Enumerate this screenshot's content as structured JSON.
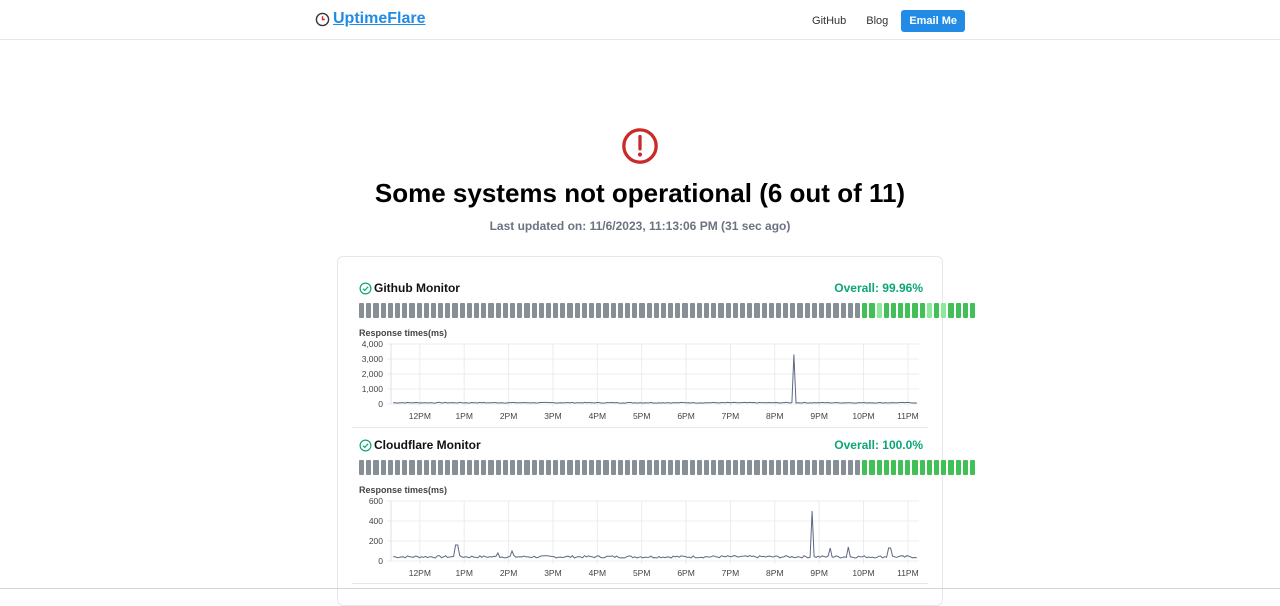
{
  "header": {
    "brand": "UptimeFlare",
    "nav": {
      "github": "GitHub",
      "blog": "Blog",
      "email": "Email Me"
    }
  },
  "status": {
    "headline": "Some systems not operational (6 out of 11)",
    "updated": "Last updated on: 11/6/2023, 11:13:06 PM (31 sec ago)"
  },
  "colors": {
    "accent": "#228be6",
    "up": "#40c057",
    "up_light": "#8ce99a",
    "no_data": "#868e96",
    "alert": "#c92a2a",
    "overall": "#0ca678"
  },
  "monitors": [
    {
      "name": "Github Monitor",
      "overall": "Overall: 99.96%",
      "response_label": "Response times(ms)",
      "bars": {
        "no_data": 70,
        "up": 16,
        "partial_indices": [
          2,
          9,
          11
        ]
      },
      "chart_data": {
        "type": "line",
        "x_ticks": [
          "12PM",
          "1PM",
          "2PM",
          "3PM",
          "4PM",
          "5PM",
          "6PM",
          "7PM",
          "8PM",
          "9PM",
          "10PM",
          "11PM"
        ],
        "y_ticks": [
          "4,000",
          "3,000",
          "2,000",
          "1,000",
          "0"
        ],
        "ylim": [
          0,
          4000
        ],
        "baseline_ms": 80,
        "spikes": [
          {
            "time": "8:25PM",
            "value": 3300
          }
        ]
      }
    },
    {
      "name": "Cloudflare Monitor",
      "overall": "Overall: 100.0%",
      "response_label": "Response times(ms)",
      "bars": {
        "no_data": 70,
        "up": 16,
        "partial_indices": []
      },
      "chart_data": {
        "type": "line",
        "x_ticks": [
          "12PM",
          "1PM",
          "2PM",
          "3PM",
          "4PM",
          "5PM",
          "6PM",
          "7PM",
          "8PM",
          "9PM",
          "10PM",
          "11PM"
        ],
        "y_ticks": [
          "600",
          "400",
          "200",
          "0"
        ],
        "ylim": [
          0,
          600
        ],
        "baseline_ms": 40,
        "spikes": [
          {
            "time": "12:50PM",
            "value": 160
          },
          {
            "time": "1:45PM",
            "value": 80
          },
          {
            "time": "2:05PM",
            "value": 100
          },
          {
            "time": "8:50PM",
            "value": 500
          },
          {
            "time": "9:15PM",
            "value": 130
          },
          {
            "time": "9:40PM",
            "value": 140
          },
          {
            "time": "10:35PM",
            "value": 130
          }
        ]
      }
    }
  ]
}
